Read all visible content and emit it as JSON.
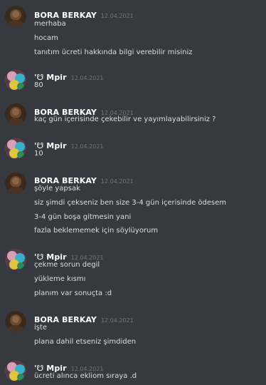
{
  "groups": [
    {
      "author": "BORA BERKAY",
      "timestamp": "12.04.2021",
      "avatar": "dark-avatar",
      "messages": [
        "merhaba",
        "hocam",
        "tanıtım ücreti hakkında bilgi verebilir misiniz"
      ]
    },
    {
      "author": "'☋ Mpir",
      "timestamp": "12.04.2021",
      "avatar": "colorful-avatar",
      "messages": [
        "80"
      ]
    },
    {
      "author": "BORA BERKAY",
      "timestamp": "12.04.2021",
      "avatar": "dark-avatar",
      "messages": [
        "kaç gün içerisinde çekebilir ve yayımlayabilirsiniz ?"
      ]
    },
    {
      "author": "'☋ Mpir",
      "timestamp": "12.04.2021",
      "avatar": "colorful-avatar",
      "messages": [
        "10"
      ]
    },
    {
      "author": "BORA BERKAY",
      "timestamp": "12.04.2021",
      "avatar": "dark-avatar",
      "messages": [
        "şöyle yapsak",
        "siz şimdi çekseniz ben size 3-4 gün içerisinde ödesem",
        "3-4 gün boşa gitmesin yani",
        "fazla beklememek için söylüyorum"
      ]
    },
    {
      "author": "'☋ Mpir",
      "timestamp": "12.04.2021",
      "avatar": "colorful-avatar",
      "messages": [
        "çekme sorun degil",
        "yükleme kısmı",
        "planım var sonuçta :d"
      ]
    },
    {
      "author": "BORA BERKAY",
      "timestamp": "12.04.2021",
      "avatar": "dark-avatar",
      "messages": [
        "işte",
        "plana dahil etseniz şimdiden"
      ]
    },
    {
      "author": "'☋ Mpir",
      "timestamp": "12.04.2021",
      "avatar": "colorful-avatar",
      "messages": [
        "ücreti alınca ekliom sıraya .d"
      ]
    }
  ]
}
